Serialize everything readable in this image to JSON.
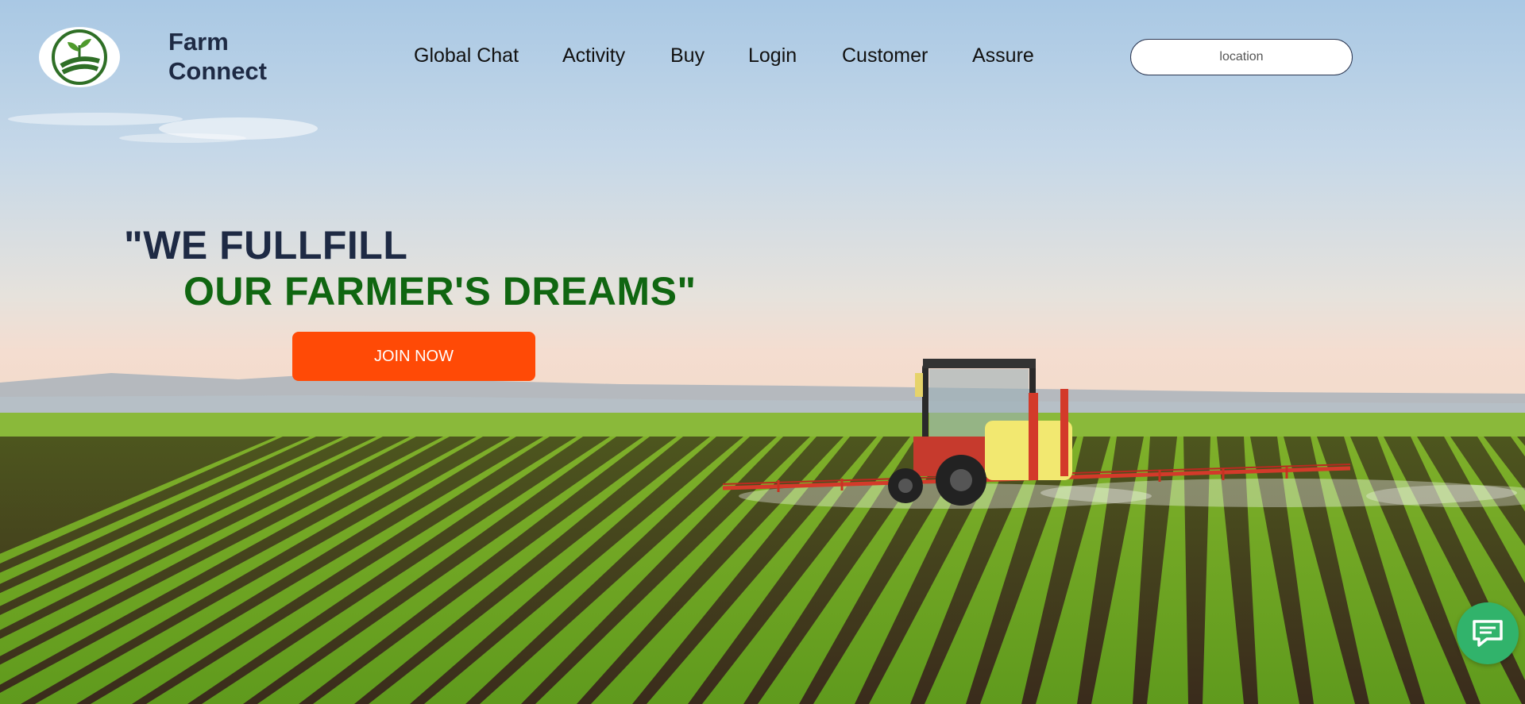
{
  "header": {
    "brand_line1": "Farm",
    "brand_line2": "Connect",
    "logo_icon": "leaf-field-logo",
    "nav": [
      {
        "label": "Global Chat"
      },
      {
        "label": "Activity"
      },
      {
        "label": "Buy"
      },
      {
        "label": "Login"
      },
      {
        "label": "Customer"
      },
      {
        "label": "Assure"
      }
    ],
    "search": {
      "placeholder": "location",
      "value": ""
    }
  },
  "hero": {
    "headline_line1": "\"WE FULLFILL",
    "headline_line2": "OUR FARMER'S DREAMS\"",
    "cta_label": "JOIN NOW",
    "background": "tractor spraying crop field"
  },
  "chat_fab": {
    "icon": "chat-bubble-icon"
  },
  "colors": {
    "brand_text": "#1e2a44",
    "headline_green": "#106611",
    "cta": "#ff4a06",
    "chat_fab": "#31b36b"
  }
}
